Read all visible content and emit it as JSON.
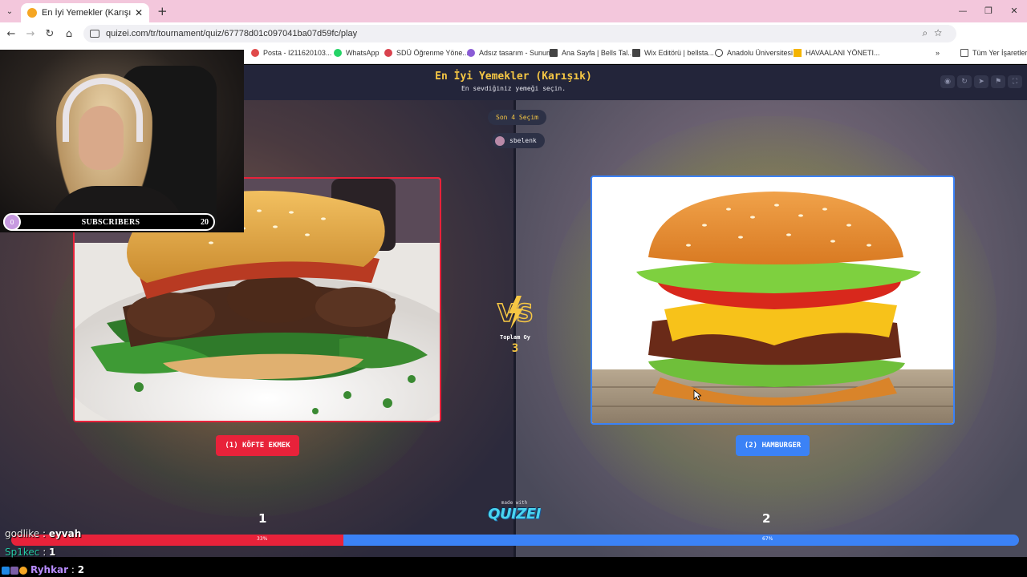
{
  "browser": {
    "tab_title": "En İyi Yemekler (Karışık) - Tier L",
    "url": "quizei.com/tr/tournament/quiz/67778d01c097041ba07d59fc/play",
    "bookmarks": [
      {
        "label": "Posta - I211620103...",
        "color": "#e04a4a"
      },
      {
        "label": "WhatsApp",
        "color": "#25d366"
      },
      {
        "label": "SDÜ Öğrenme Yöne...",
        "color": "#d9434e"
      },
      {
        "label": "Adsız tasarım - Sunum",
        "color": "#8a5cd6"
      },
      {
        "label": "Ana Sayfa | Bells Tal...",
        "color": "#444"
      },
      {
        "label": "Wix Editörü | bellsta...",
        "color": "#444"
      },
      {
        "label": "Anadolu Üniversitesi",
        "color": "#333"
      },
      {
        "label": "HAVAALANI YÖNETI...",
        "color": "#f4b400"
      }
    ],
    "all_bookmarks": "Tüm Yer İşaretleri"
  },
  "stream": {
    "subscribers_label": "SUBSCRIBERS",
    "subscribers_start": "0",
    "subscribers_goal": "20"
  },
  "quiz": {
    "title": "En İyi Yemekler (Karışık)",
    "subtitle": "En sevdiğiniz yemeği seçin.",
    "last_pick_label": "Son 4 Seçim",
    "user": "sbelenk",
    "total_label": "Toplam Oy",
    "total_value": "3",
    "made_with": "made with",
    "logo": "QUIZEI",
    "left_choice": "(1) KÖFTE EKMEK",
    "right_choice": "(2) HAMBURGER",
    "left_rank": "1",
    "right_rank": "2",
    "left_percent": "33%",
    "right_percent": "67%",
    "left_share": 0.33,
    "right_share": 0.67
  },
  "chat": [
    {
      "user": "godlike",
      "message": "eyvah"
    },
    {
      "user": "Sp1kec",
      "message": "1"
    },
    {
      "user": "Ryhkar",
      "message": "2"
    }
  ],
  "colors": {
    "left_accent": "#e8223a",
    "right_accent": "#3b82f6",
    "title_yellow": "#f6c744"
  }
}
